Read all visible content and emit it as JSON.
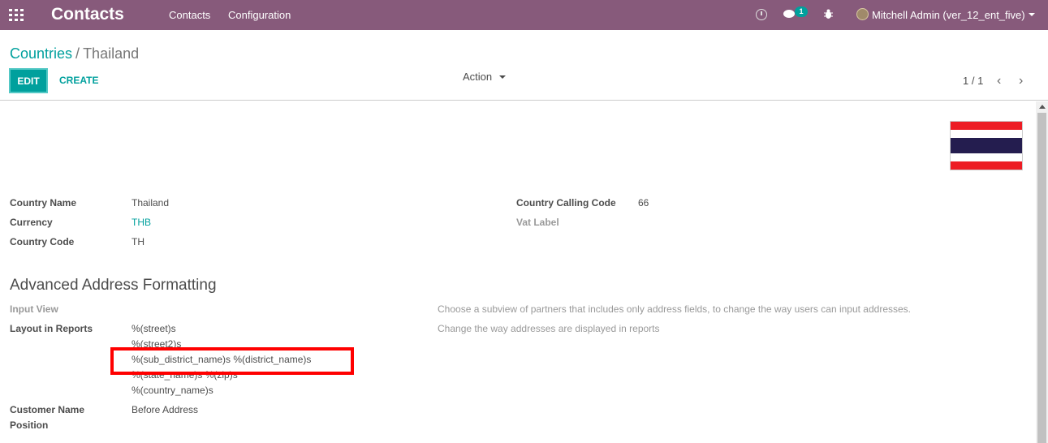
{
  "navbar": {
    "app_title": "Contacts",
    "menus": [
      "Contacts",
      "Configuration"
    ],
    "chat_badge": "1",
    "user_name": "Mitchell Admin (ver_12_ent_five)",
    "bg_color": "#875a7b"
  },
  "control_panel": {
    "breadcrumb_parent": "Countries",
    "breadcrumb_sep": "/",
    "breadcrumb_current": "Thailand",
    "edit_label": "EDIT",
    "create_label": "CREATE",
    "action_label": "Action",
    "pager": "1 / 1",
    "prev_icon": "‹",
    "next_icon": "›"
  },
  "form": {
    "country_name_label": "Country Name",
    "country_name": "Thailand",
    "currency_label": "Currency",
    "currency": "THB",
    "country_code_label": "Country Code",
    "country_code": "TH",
    "calling_code_label": "Country Calling Code",
    "calling_code": "66",
    "vat_label_label": "Vat Label",
    "section_title": "Advanced Address Formatting",
    "input_view_label": "Input View",
    "input_view_help": "Choose a subview of partners that includes only address fields, to change the way users can input addresses.",
    "layout_label": "Layout in Reports",
    "layout_help": "Change the way addresses are displayed in reports",
    "layout_lines": [
      "%(street)s",
      "%(street2)s",
      "%(sub_district_name)s %(district_name)s",
      "%(state_name)s %(zip)s",
      "%(country_name)s"
    ],
    "customer_name_position_label_1": "Customer Name",
    "customer_name_position_label_2": "Position",
    "customer_name_position": "Before Address"
  },
  "colors": {
    "accent": "#00a09d",
    "highlight": "#ff0000",
    "flag_red": "#ed1c24",
    "flag_blue": "#241d4f"
  }
}
